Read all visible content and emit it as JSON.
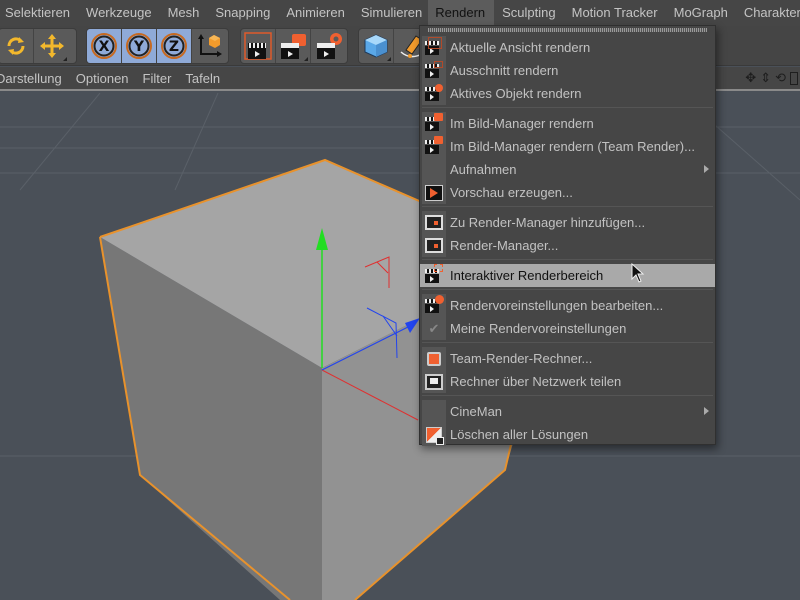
{
  "menubar": {
    "items": [
      "Selektieren",
      "Werkzeuge",
      "Mesh",
      "Snapping",
      "Animieren",
      "Simulieren",
      "Rendern",
      "Sculpting",
      "Motion Tracker",
      "MoGraph",
      "Charakter"
    ],
    "active": "Rendern"
  },
  "toolbar": {
    "groups": [
      {
        "buttons": [
          {
            "icon": "rotate-icon"
          },
          {
            "icon": "move-icon"
          }
        ]
      },
      {
        "buttons": [
          {
            "icon": "x-axis-lock-icon",
            "label": "X"
          },
          {
            "icon": "y-axis-lock-icon",
            "label": "Y"
          },
          {
            "icon": "z-axis-lock-icon",
            "label": "Z"
          },
          {
            "icon": "coordinate-system-icon"
          }
        ]
      },
      {
        "buttons": [
          {
            "icon": "render-view-icon"
          },
          {
            "icon": "render-picture-viewer-icon"
          },
          {
            "icon": "render-settings-icon"
          }
        ]
      },
      {
        "buttons": [
          {
            "icon": "cube-icon"
          },
          {
            "icon": "pen-icon"
          }
        ]
      }
    ]
  },
  "viewmenu": {
    "items": [
      "Darstellung",
      "Optionen",
      "Filter",
      "Tafeln"
    ]
  },
  "dropdown": {
    "items": [
      {
        "label": "Aktuelle Ansicht rendern",
        "icon": "render-view-icon"
      },
      {
        "label": "Ausschnitt rendern",
        "icon": "render-region-icon"
      },
      {
        "label": "Aktives Objekt rendern",
        "icon": "render-active-object-icon"
      },
      {
        "separator": true
      },
      {
        "label": "Im Bild-Manager rendern",
        "icon": "render-picture-viewer-icon"
      },
      {
        "label": "Im Bild-Manager rendern (Team Render)...",
        "icon": "team-render-picture-viewer-icon"
      },
      {
        "label": "Aufnahmen",
        "submenu": true
      },
      {
        "label": "Vorschau erzeugen...",
        "icon": "make-preview-icon"
      },
      {
        "separator": true
      },
      {
        "label": "Zu Render-Manager hinzufügen...",
        "icon": "add-render-queue-icon"
      },
      {
        "label": "Render-Manager...",
        "icon": "render-queue-icon"
      },
      {
        "separator": true
      },
      {
        "label": "Interaktiver Renderbereich",
        "icon": "interactive-render-region-icon",
        "hovered": true
      },
      {
        "separator": true
      },
      {
        "label": "Rendervoreinstellungen bearbeiten...",
        "icon": "edit-render-settings-icon"
      },
      {
        "label": "Meine Rendervoreinstellungen",
        "icon": "checkmark-icon",
        "checked": true
      },
      {
        "separator": true
      },
      {
        "label": "Team-Render-Rechner...",
        "icon": "team-render-machines-icon"
      },
      {
        "label": "Rechner über Netzwerk teilen",
        "icon": "share-machine-icon"
      },
      {
        "separator": true
      },
      {
        "label": "CineMan",
        "submenu": true
      },
      {
        "label": "Löschen aller Lösungen",
        "icon": "flush-caches-icon"
      }
    ]
  },
  "colors": {
    "selection_outline": "#e8922c",
    "axis_x": "#e03030",
    "axis_y": "#22dd22",
    "axis_z": "#2244ee",
    "accent_orange": "#f06030",
    "menu_hover": "#a9a9a9"
  }
}
